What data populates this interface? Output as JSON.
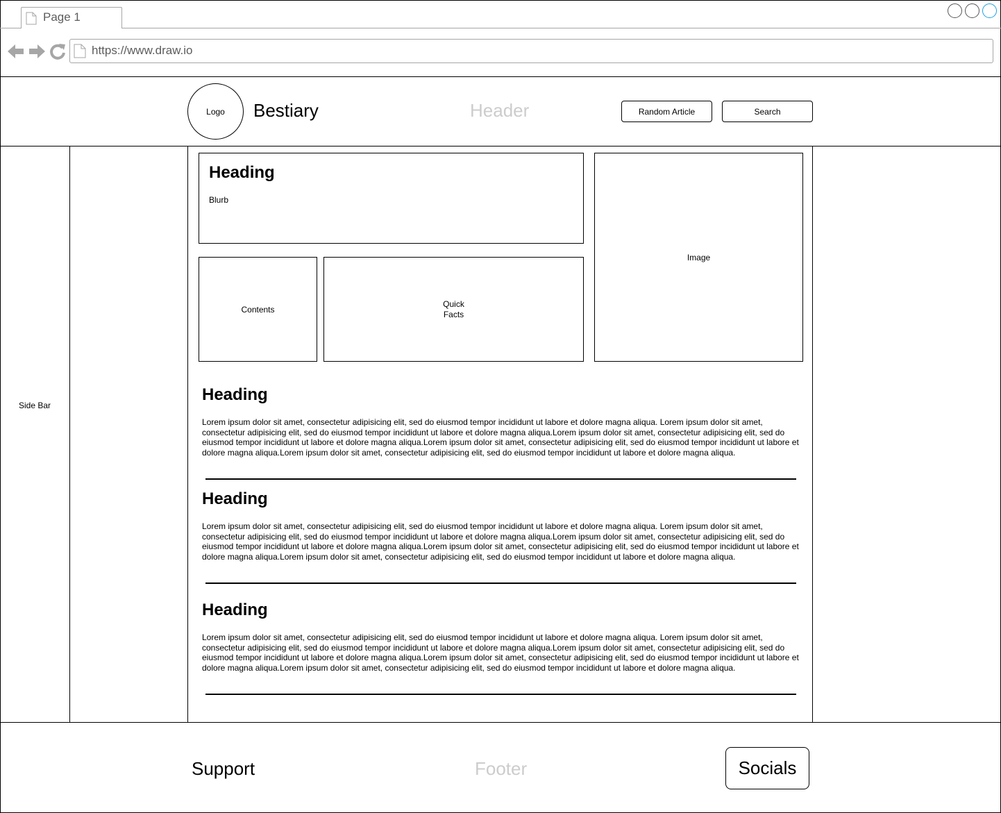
{
  "browser": {
    "tab_label": "Page 1",
    "url": "https://www.draw.io"
  },
  "header": {
    "logo_label": "Logo",
    "site_title": "Bestiary",
    "region_label": "Header",
    "random_article_label": "Random Article",
    "search_label": "Search"
  },
  "sidebar": {
    "label": "Side Bar"
  },
  "intro": {
    "heading": "Heading",
    "blurb": "Blurb",
    "image_label": "Image",
    "contents_label": "Contents",
    "quick_facts_line1": "Quick",
    "quick_facts_line2": "Facts"
  },
  "sections": [
    {
      "heading": "Heading",
      "body": "Lorem ipsum dolor sit amet, consectetur adipisicing elit, sed do eiusmod tempor incididunt ut labore et dolore magna aliqua. Lorem ipsum dolor sit amet, consectetur adipisicing elit, sed do eiusmod tempor incididunt ut labore et dolore magna aliqua.Lorem ipsum dolor sit amet, consectetur adipisicing elit, sed do eiusmod tempor incididunt ut labore et dolore magna aliqua.Lorem ipsum dolor sit amet, consectetur adipisicing elit, sed do eiusmod tempor incididunt ut labore et dolore magna aliqua.Lorem ipsum dolor sit amet, consectetur adipisicing elit, sed do eiusmod tempor incididunt ut labore et dolore magna aliqua."
    },
    {
      "heading": "Heading",
      "body": "Lorem ipsum dolor sit amet, consectetur adipisicing elit, sed do eiusmod tempor incididunt ut labore et dolore magna aliqua. Lorem ipsum dolor sit amet, consectetur adipisicing elit, sed do eiusmod tempor incididunt ut labore et dolore magna aliqua.Lorem ipsum dolor sit amet, consectetur adipisicing elit, sed do eiusmod tempor incididunt ut labore et dolore magna aliqua.Lorem ipsum dolor sit amet, consectetur adipisicing elit, sed do eiusmod tempor incididunt ut labore et dolore magna aliqua.Lorem ipsum dolor sit amet, consectetur adipisicing elit, sed do eiusmod tempor incididunt ut labore et dolore magna aliqua."
    },
    {
      "heading": "Heading",
      "body": "Lorem ipsum dolor sit amet, consectetur adipisicing elit, sed do eiusmod tempor incididunt ut labore et dolore magna aliqua. Lorem ipsum dolor sit amet, consectetur adipisicing elit, sed do eiusmod tempor incididunt ut labore et dolore magna aliqua.Lorem ipsum dolor sit amet, consectetur adipisicing elit, sed do eiusmod tempor incididunt ut labore et dolore magna aliqua.Lorem ipsum dolor sit amet, consectetur adipisicing elit, sed do eiusmod tempor incididunt ut labore et dolore magna aliqua.Lorem ipsum dolor sit amet, consectetur adipisicing elit, sed do eiusmod tempor incididunt ut labore et dolore magna aliqua."
    }
  ],
  "footer": {
    "support_label": "Support",
    "region_label": "Footer",
    "socials_label": "Socials"
  },
  "colors": {
    "line": "#000000",
    "muted_label": "#cccccc",
    "chrome_gray": "#a6a6a6",
    "accent_window_button": "#1ba1e2"
  }
}
